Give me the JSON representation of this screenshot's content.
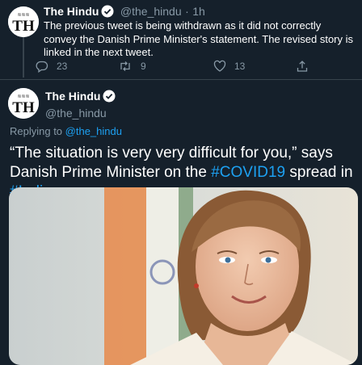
{
  "tweet1": {
    "name": "The Hindu",
    "handle": "@the_hindu",
    "separator": "·",
    "time": "1h",
    "text": "The previous tweet is being withdrawn as it did not correctly convey the Danish Prime Minister's statement. The revised story is linked in the next tweet.",
    "replies": "23",
    "retweets": "9",
    "likes": "13"
  },
  "tweet2": {
    "name": "The Hindu",
    "handle": "@the_hindu",
    "replying_prefix": "Replying to ",
    "replying_handle": "@the_hindu",
    "text_before": "“The situation is very very difficult for you,” says Danish Prime Minister on the ",
    "hashtag1": "#COVID19",
    "text_middle": " spread in ",
    "hashtag2": "#India",
    "text_end": "."
  },
  "avatar_text": "TH",
  "colors": {
    "background": "#15202b",
    "accent": "#1da1f2",
    "muted": "#8899a6",
    "divider": "#38444d"
  },
  "icons": [
    "reply-icon",
    "retweet-icon",
    "like-icon",
    "share-icon",
    "verified-badge-icon"
  ]
}
